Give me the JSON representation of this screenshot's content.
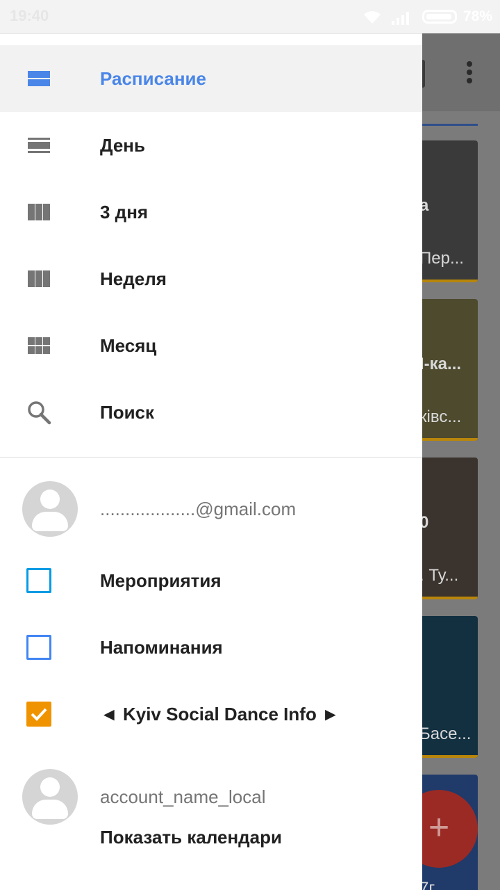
{
  "status_bar": {
    "time": "19:40",
    "battery": "78%"
  },
  "drawer": {
    "views": [
      {
        "label": "Расписание",
        "icon": "schedule-view-icon",
        "active": true
      },
      {
        "label": "День",
        "icon": "day-view-icon"
      },
      {
        "label": "3 дня",
        "icon": "three-day-view-icon"
      },
      {
        "label": "Неделя",
        "icon": "week-view-icon"
      },
      {
        "label": "Месяц",
        "icon": "month-view-icon"
      },
      {
        "label": "Поиск",
        "icon": "search-icon"
      }
    ],
    "account1": "...................@gmail.com",
    "calendars": [
      {
        "label": "Мероприятия",
        "checked": false,
        "color": "#039be5"
      },
      {
        "label": "Напоминания",
        "checked": false,
        "color": "#4285f4"
      },
      {
        "label": "◄ Kyiv Social Dance Info ►",
        "checked": true,
        "color": "#f09300"
      }
    ],
    "account2": "account_name_local",
    "show_calendars": "Показать календари"
  },
  "background": {
    "cards": [
      {
        "line1": "а",
        "line2": "Пер..."
      },
      {
        "line1": "I-ка...",
        "line2": "ківс..."
      },
      {
        "line1": "0",
        "line2": ". Ту..."
      },
      {
        "line1": "",
        "line2": "Басе..."
      },
      {
        "line1": "",
        "line2": "7г"
      }
    ]
  },
  "colors": {
    "accent": "#4a86e8",
    "fab": "#db4437"
  }
}
